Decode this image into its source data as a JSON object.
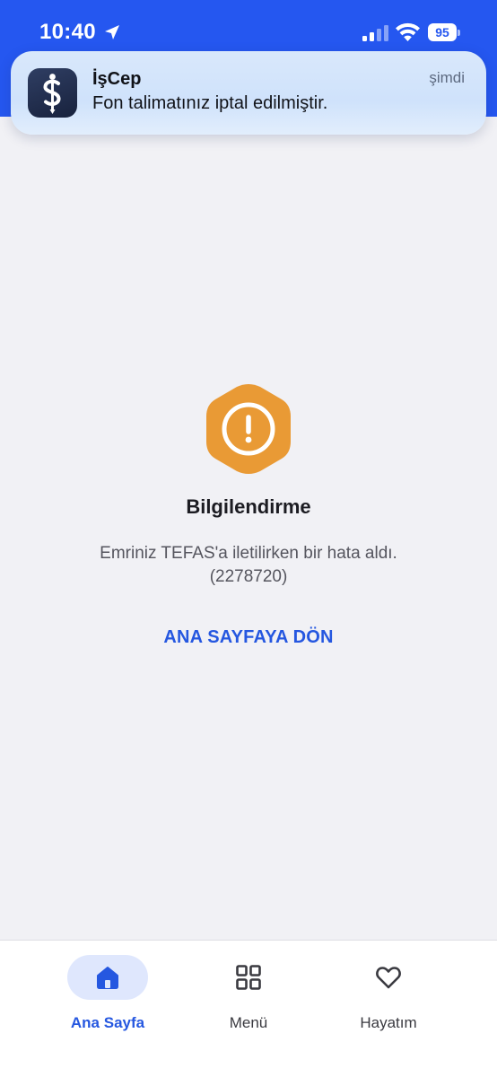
{
  "status_bar": {
    "time": "10:40",
    "battery": "95"
  },
  "notification": {
    "app_name": "İşCep",
    "time": "şimdi",
    "message": "Fon talimatınız iptal edilmiştir."
  },
  "info": {
    "title": "Bilgilendirme",
    "message_line1": "Emriniz TEFAS'a iletilirken bir hata aldı.",
    "message_line2": "(2278720)",
    "home_link": "ANA SAYFAYA DÖN"
  },
  "bottom_nav": {
    "items": [
      {
        "label": "Ana Sayfa",
        "icon": "home-icon",
        "active": true
      },
      {
        "label": "Menü",
        "icon": "grid-icon",
        "active": false
      },
      {
        "label": "Hayatım",
        "icon": "heart-icon",
        "active": false
      }
    ]
  },
  "colors": {
    "brand_blue": "#2557f0",
    "warning_orange": "#e99a35",
    "background": "#f1f1f5"
  }
}
